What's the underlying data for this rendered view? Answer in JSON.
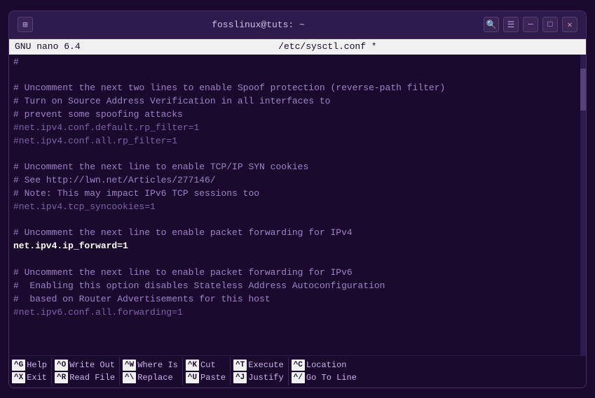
{
  "window": {
    "title": "fosslinux@tuts: ~",
    "pin_icon": "📌"
  },
  "nano": {
    "version": "GNU nano 6.4",
    "filename": "/etc/sysctl.conf *"
  },
  "editor": {
    "lines": [
      {
        "text": "#",
        "type": "comment"
      },
      {
        "text": "",
        "type": "normal"
      },
      {
        "text": "# Uncomment the next two lines to enable Spoof protection (reverse-path filter)",
        "type": "comment"
      },
      {
        "text": "# Turn on Source Address Verification in all interfaces to",
        "type": "comment"
      },
      {
        "text": "# prevent some spoofing attacks",
        "type": "comment"
      },
      {
        "text": "#net.ipv4.conf.default.rp_filter=1",
        "type": "disabled"
      },
      {
        "text": "#net.ipv4.conf.all.rp_filter=1",
        "type": "disabled"
      },
      {
        "text": "",
        "type": "normal"
      },
      {
        "text": "# Uncomment the next line to enable TCP/IP SYN cookies",
        "type": "comment"
      },
      {
        "text": "# See http://lwn.net/Articles/277146/",
        "type": "comment"
      },
      {
        "text": "# Note: This may impact IPv6 TCP sessions too",
        "type": "comment"
      },
      {
        "text": "#net.ipv4.tcp_syncookies=1",
        "type": "disabled"
      },
      {
        "text": "",
        "type": "normal"
      },
      {
        "text": "# Uncomment the next line to enable packet forwarding for IPv4",
        "type": "comment"
      },
      {
        "text": "net.ipv4.ip_forward=1",
        "type": "highlighted"
      },
      {
        "text": "",
        "type": "normal"
      },
      {
        "text": "# Uncomment the next line to enable packet forwarding for IPv6",
        "type": "comment"
      },
      {
        "text": "#  Enabling this option disables Stateless Address Autoconfiguration",
        "type": "comment"
      },
      {
        "text": "#  based on Router Advertisements for this host",
        "type": "comment"
      },
      {
        "text": "#net.ipv6.conf.all.forwarding=1",
        "type": "disabled"
      }
    ]
  },
  "shortcuts": [
    {
      "items": [
        {
          "key": "^G",
          "label": "Help"
        },
        {
          "key": "^X",
          "label": "Exit"
        }
      ]
    },
    {
      "items": [
        {
          "key": "^O",
          "label": "Write Out"
        },
        {
          "key": "^R",
          "label": "Read File"
        }
      ]
    },
    {
      "items": [
        {
          "key": "^W",
          "label": "Where Is"
        },
        {
          "key": "^\\",
          "label": "Replace"
        }
      ]
    },
    {
      "items": [
        {
          "key": "^K",
          "label": "Cut"
        },
        {
          "key": "^U",
          "label": "Paste"
        }
      ]
    },
    {
      "items": [
        {
          "key": "^T",
          "label": "Execute"
        },
        {
          "key": "^J",
          "label": "Justify"
        }
      ]
    },
    {
      "items": [
        {
          "key": "^C",
          "label": "Location"
        },
        {
          "key": "^/",
          "label": "Go To Line"
        }
      ]
    }
  ],
  "icons": {
    "search": "🔍",
    "menu": "☰",
    "minimize": "─",
    "maximize": "□",
    "close": "✕",
    "pin": "⊞"
  }
}
